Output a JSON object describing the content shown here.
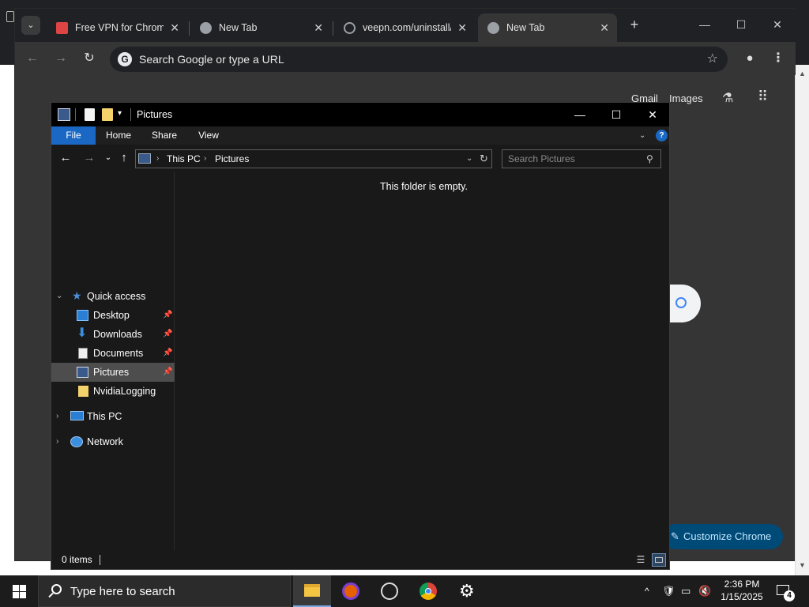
{
  "chrome": {
    "tabs": [
      {
        "title": "Free VPN for Chrome",
        "favicon": "veepn-favicon"
      },
      {
        "title": "New Tab",
        "favicon": "chrome-favicon"
      },
      {
        "title": "veepn.com/uninstall/",
        "favicon": "globe-favicon"
      },
      {
        "title": "New Tab",
        "favicon": "chrome-favicon"
      }
    ],
    "active_tab": 3,
    "omnibox_placeholder": "Search Google or type a URL",
    "ntp": {
      "gmail": "Gmail",
      "images": "Images",
      "customize": "Customize Chrome"
    }
  },
  "explorer": {
    "title": "Pictures",
    "ribbon_tabs": [
      "File",
      "Home",
      "Share",
      "View"
    ],
    "breadcrumb": [
      "This PC",
      "Pictures"
    ],
    "search_placeholder": "Search Pictures",
    "nav": {
      "quick_access": "Quick access",
      "desktop": "Desktop",
      "downloads": "Downloads",
      "documents": "Documents",
      "pictures": "Pictures",
      "nvidialogging": "NvidiaLogging",
      "this_pc": "This PC",
      "network": "Network"
    },
    "empty_message": "This folder is empty.",
    "status_count": "0 items"
  },
  "taskbar": {
    "search_text": "Type here to search",
    "time": "2:36 PM",
    "date": "1/15/2025",
    "notification_count": "4"
  },
  "colors": {
    "file_tab": "#1a68c4",
    "selected_nav": "#4d4d4d",
    "customize_bg": "#004a77",
    "explorer_bg": "#191919"
  }
}
